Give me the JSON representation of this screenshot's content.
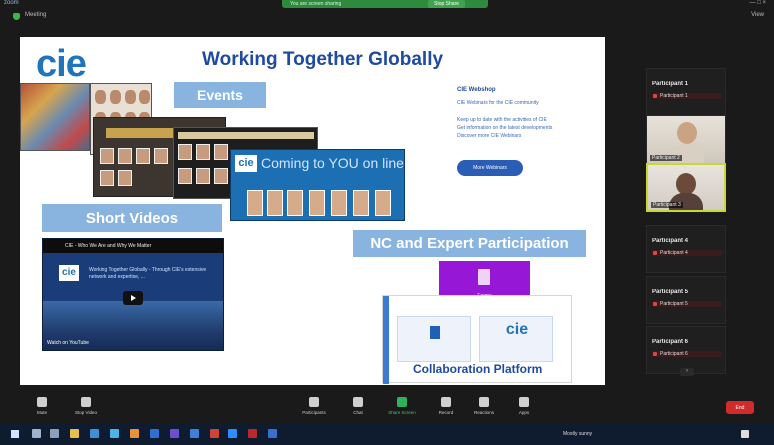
{
  "window": {
    "app_logo": "zoom",
    "sharing_text": "You are screen sharing",
    "stop_share_label": "Stop Share",
    "controls": "—  □  ×"
  },
  "header": {
    "meeting_info": "Meeting",
    "view_label": "View"
  },
  "slide": {
    "logo_text": "cie",
    "title": "Working Together Globally",
    "events_label": "Events",
    "coming_cie": "cie",
    "coming_text": "Coming to YOU on line",
    "webinar_title": "CIE Webshop",
    "webinar_lines": [
      "CIE Webinars for the CIE community",
      "Keep up to date with the activities of CIE",
      "Get information on the latest developments",
      "Discover more CIE Webinars"
    ],
    "webinar_button": "More Webinars",
    "videos_label": "Short Videos",
    "video_title": "CIE - Who We Are and Why We Matter",
    "video_cie": "cie",
    "video_desc": "Working Together Globally - Through CIE's extensive network and expertise, ...",
    "video_footer": "Watch on YouTube",
    "nc_label": "NC and Expert Participation",
    "forms_label": "Forms",
    "collab_cie": "cie",
    "collab_label": "Collaboration Platform"
  },
  "participants": [
    {
      "name": "Participant 1",
      "sub": "Participant 1"
    },
    {
      "name": "Participant 4",
      "sub": "Participant 4"
    },
    {
      "name": "Participant 5",
      "sub": "Participant 5"
    },
    {
      "name": "Participant 6",
      "sub": "Participant 6"
    }
  ],
  "video_participants": [
    {
      "name": "Participant 2"
    },
    {
      "name": "Participant 3"
    }
  ],
  "toolbar": {
    "mute": "Mute",
    "stop_video": "Stop Video",
    "participants": "Participants",
    "chat": "Chat",
    "share_screen": "Share Screen",
    "record": "Record",
    "reactions": "Reactions",
    "apps": "Apps",
    "end": "End"
  },
  "taskbar": {
    "weather": "Mostly sunny",
    "clock_time": "",
    "clock_date": ""
  }
}
